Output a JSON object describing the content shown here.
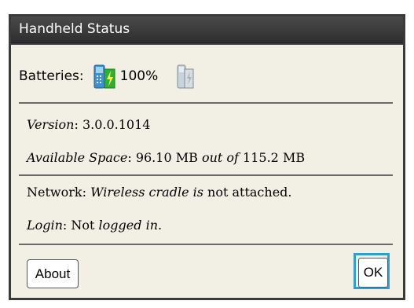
{
  "dialog": {
    "title": "Handheld Status"
  },
  "batteries": {
    "label": "Batteries:",
    "percent": "100%",
    "icons": [
      "battery-full-charging-icon",
      "battery-empty-icon"
    ]
  },
  "info": {
    "version_label": "Version",
    "version_value": ": 3.0.0.1014",
    "space_label": "Available Space",
    "space_value": ": 96.10 MB",
    "space_mid": " out of ",
    "space_total": "115.2 MB",
    "network_label": "Network",
    "network_sep": ": ",
    "network_value_italic": "Wireless cradle is",
    "network_value": " not attached",
    "network_end": ".",
    "login_label": "Login",
    "login_value": ": Not ",
    "login_value_italic": "logged in",
    "login_end": "."
  },
  "buttons": {
    "about": "About",
    "ok": "OK"
  },
  "colors": {
    "title_bar": "#3a3a3a",
    "body_bg": "#f2efe4",
    "focus": "#2d9fd0"
  }
}
